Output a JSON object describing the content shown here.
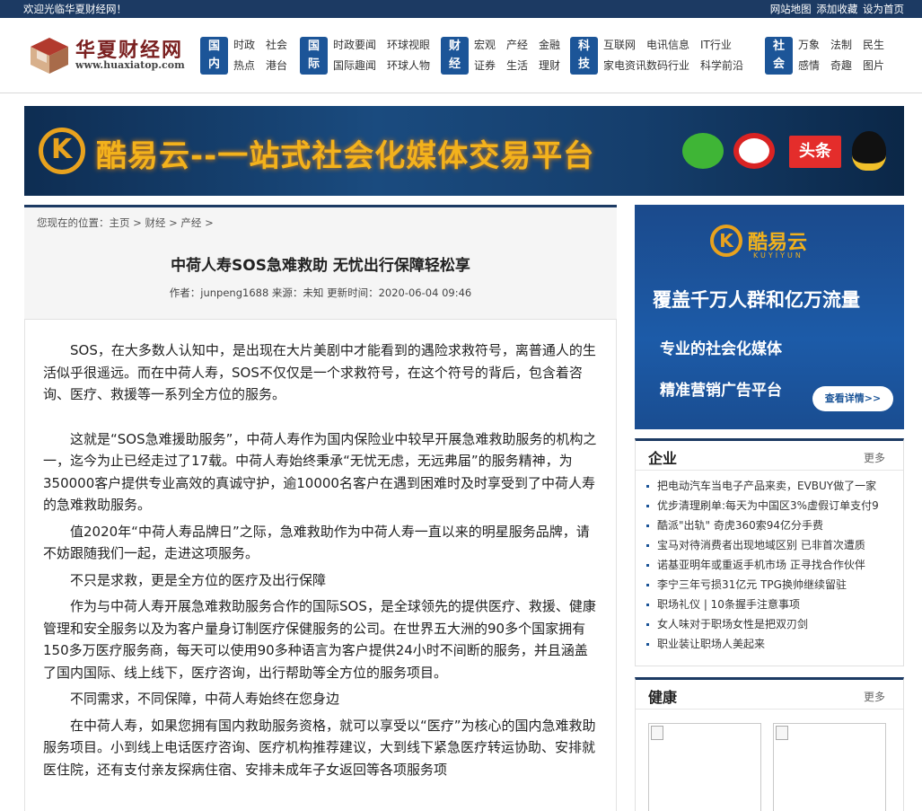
{
  "topbar": {
    "welcome": "欢迎光临华夏财经网！",
    "links": [
      "网站地图",
      "添加收藏",
      "设为首页"
    ]
  },
  "logo": {
    "name": "华夏财经网",
    "url": "www.huaxiatop.com"
  },
  "nav": [
    {
      "badge": [
        "国",
        "内"
      ],
      "items": [
        "时政",
        "社会",
        "热点",
        "港台"
      ]
    },
    {
      "badge": [
        "国",
        "际"
      ],
      "items": [
        "时政要闻",
        "环球视眼",
        "国际趣闻",
        "环球人物"
      ]
    },
    {
      "badge": [
        "财",
        "经"
      ],
      "items": [
        "宏观",
        "产经",
        "金融",
        "证券",
        "生活",
        "理财"
      ]
    },
    {
      "badge": [
        "科",
        "技"
      ],
      "items": [
        "互联网",
        "电讯信息",
        "IT行业",
        "家电资讯",
        "数码行业",
        "科学前沿"
      ]
    },
    {
      "badge": [
        "社",
        "会"
      ],
      "items": [
        "万象",
        "法制",
        "民生",
        "感情",
        "奇趣",
        "图片"
      ]
    }
  ],
  "banner": {
    "slogan": "酷易云--一站式社会化媒体交易平台",
    "toutiao": "头条"
  },
  "breadcrumb": {
    "prefix": "您现在的位置：",
    "items": [
      "主页",
      "财经",
      "产经"
    ],
    "sep": ">"
  },
  "article": {
    "title": "中荷人寿SOS急难救助 无忧出行保障轻松享",
    "meta": "作者：junpeng1688    来源：未知 更新时间：2020-06-04 09:46",
    "paragraphs": [
      "SOS，在大多数人认知中，是出现在大片美剧中才能看到的遇险求救符号，离普通人的生活似乎很遥远。而在中荷人寿，SOS不仅仅是一个求救符号，在这个符号的背后，包含着咨询、医疗、救援等一系列全方位的服务。",
      "这就是“SOS急难援助服务”，中荷人寿作为国内保险业中较早开展急难救助服务的机构之一，迄今为止已经走过了17载。中荷人寿始终秉承“无忧无虑，无远弗届”的服务精神，为350000客户提供专业高效的真诚守护，逾10000名客户在遇到困难时及时享受到了中荷人寿的急难救助服务。",
      "值2020年“中荷人寿品牌日”之际，急难救助作为中荷人寿一直以来的明星服务品牌，请不妨跟随我们一起，走进这项服务。",
      "不只是求救，更是全方位的医疗及出行保障",
      "作为与中荷人寿开展急难救助服务合作的国际SOS，是全球领先的提供医疗、救援、健康管理和安全服务以及为客户量身订制医疗保健服务的公司。在世界五大洲的90多个国家拥有150多万医疗服务商，每天可以使用90多种语言为客户提供24小时不间断的服务，并且涵盖了国内国际、线上线下，医疗咨询，出行帮助等全方位的服务项目。",
      "不同需求，不同保障，中荷人寿始终在您身边",
      "在中荷人寿，如果您拥有国内救助服务资格，就可以享受以“医疗”为核心的国内急难救助服务项目。小到线上电话医疗咨询、医疗机构推荐建议，大到线下紧急医疗转运协助、安排就医住院，还有支付亲友探病住宿、安排未成年子女返回等各项服务项"
    ]
  },
  "side_ad": {
    "brand": "酷易云",
    "brand_en": "KUYIYUN",
    "line1": "覆盖千万人群和亿万流量",
    "line2": "专业的社会化媒体",
    "line3": "精准营销广告平台",
    "button": "查看详情>>"
  },
  "enterprise": {
    "title": "企业",
    "more": "更多",
    "items": [
      "把电动汽车当电子产品来卖，EVBUY做了一家",
      "优步清理刷单:每天为中国区3%虚假订单支付9",
      "酷派\"出轨\" 奇虎360索94亿分手费",
      "宝马对待消费者出现地域区别 已非首次遭质",
      "诺基亚明年或重返手机市场 正寻找合作伙伴",
      "李宁三年亏损31亿元 TPG换帅继续留驻",
      "职场礼仪 | 10条握手注意事项",
      "女人味对于职场女性是把双刃剑",
      "职业装让职场人美起来"
    ]
  },
  "health": {
    "title": "健康",
    "more": "更多"
  },
  "colors": {
    "navy": "#1c3a63",
    "badge_blue": "#1c5598",
    "logo_red": "#7a2020",
    "banner_gold": "#f3b21c"
  }
}
